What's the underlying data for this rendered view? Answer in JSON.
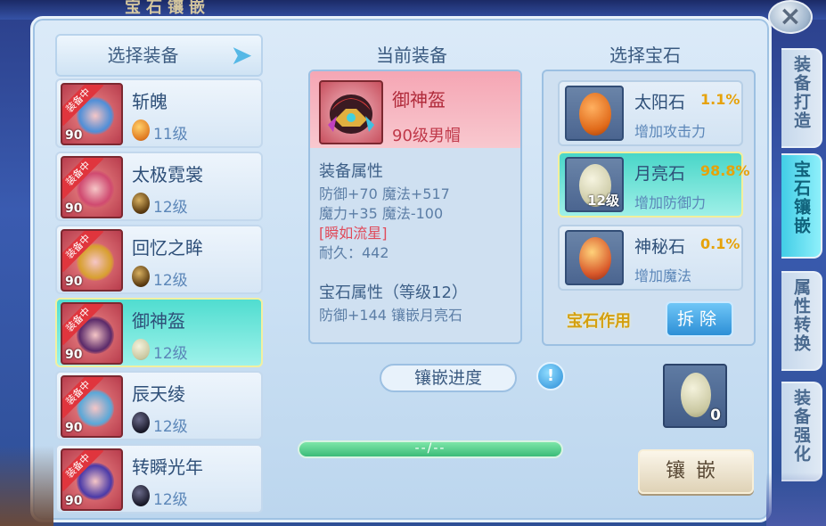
{
  "window": {
    "title_partial": "宝石镶嵌"
  },
  "left": {
    "header": "选择装备",
    "items": [
      {
        "name": "斩魄",
        "badge": "装备中",
        "level": "90",
        "gem_level": "11级",
        "gem": "sun",
        "art_color": "#4f8fd8"
      },
      {
        "name": "太极霓裳",
        "badge": "装备中",
        "level": "90",
        "gem_level": "12级",
        "gem": "dark-gold",
        "art_color": "#d04a70"
      },
      {
        "name": "回忆之眸",
        "badge": "装备中",
        "level": "90",
        "gem_level": "12级",
        "gem": "dark-gold",
        "art_color": "#d8a030"
      },
      {
        "name": "御神盔",
        "badge": "装备中",
        "level": "90",
        "gem_level": "12级",
        "gem": "moon",
        "art_color": "#5a2a6a"
      },
      {
        "name": "辰天绫",
        "badge": "装备中",
        "level": "90",
        "gem_level": "12级",
        "gem": "black",
        "art_color": "#5aa8d8"
      },
      {
        "name": "转瞬光年",
        "badge": "装备中",
        "level": "90",
        "gem_level": "12级",
        "gem": "black",
        "art_color": "#4a3aa8"
      }
    ]
  },
  "center": {
    "title": "当前装备",
    "equip_name": "御神盔",
    "equip_sub": "90级男帽",
    "attr_title": "装备属性",
    "attrs": [
      "防御+70 魔法+517",
      "魔力+35 魔法-100"
    ],
    "special": "[瞬如流星]",
    "durability": "耐久：442",
    "gem_attr_title": "宝石属性（等级12）",
    "gem_attr": "防御+144 镶嵌月亮石",
    "progress_label": "镶嵌进度",
    "info": "!",
    "progress_text": "--/--"
  },
  "right": {
    "title": "选择宝石",
    "gems": [
      {
        "name": "太阳石",
        "pct": "1.1%",
        "desc": "增加攻击力",
        "level": "",
        "color": "#e07a2a"
      },
      {
        "name": "月亮石",
        "pct": "98.8%",
        "desc": "增加防御力",
        "level": "12级",
        "color": "#d9d8b8"
      },
      {
        "name": "神秘石",
        "pct": "0.1%",
        "desc": "增加魔法",
        "level": "",
        "color": "#e89a4a"
      }
    ],
    "effect_label": "宝石作用",
    "remove_label": "拆除",
    "inventory_count": "0",
    "inlay_label": "镶嵌"
  },
  "tabs": [
    {
      "label": "装备打造"
    },
    {
      "label": "宝石镶嵌"
    },
    {
      "label": "属性转换"
    },
    {
      "label": "装备强化"
    }
  ],
  "close": "×"
}
